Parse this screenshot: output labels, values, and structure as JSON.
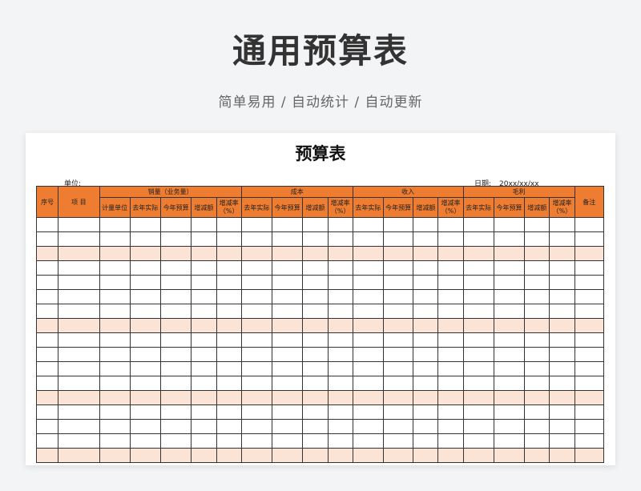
{
  "page": {
    "title": "通用预算表",
    "subtitle": "简单易用 / 自动统计 / 自动更新"
  },
  "sheet": {
    "title": "预算表",
    "unit_label": "单位:",
    "date_label": "日期:",
    "date_value": "20xx/xx/xx",
    "headers": {
      "seq": "序号",
      "item": "项 目",
      "sales_group": "销量（业务量）",
      "cost_group": "成本",
      "income_group": "收入",
      "margin_group": "毛利",
      "remarks": "备注",
      "unit": "计量单位",
      "last_year": "去年实际",
      "this_year": "今年预算",
      "change_amt": "增减额",
      "change_rate": "增减率（%）"
    },
    "row_count": 17,
    "shaded_rows": [
      2,
      7,
      12,
      16
    ]
  },
  "colors": {
    "header_orange": "#ee7d31",
    "row_shade": "#fbe3d5",
    "grid_line": "#333333"
  }
}
